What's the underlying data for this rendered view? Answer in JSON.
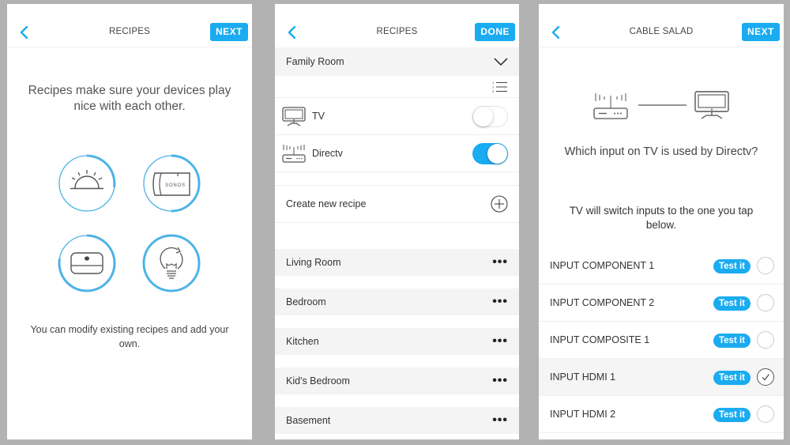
{
  "colors": {
    "accent": "#1aabf0",
    "background": "#b2b2b2"
  },
  "screens": [
    {
      "header": {
        "back_icon": "chevron-left-icon",
        "title": "RECIPES",
        "action_label": "NEXT"
      },
      "intro": "Recipes make sure your devices play nice with each other.",
      "icons": [
        "sunrise-icon",
        "sonos-speaker-icon",
        "apple-tv-icon",
        "smart-bulb-icon"
      ],
      "footer": "You can modify existing recipes and add your own."
    },
    {
      "header": {
        "back_icon": "chevron-left-icon",
        "title": "RECIPES",
        "action_label": "DONE"
      },
      "expanded_room": {
        "name": "Family Room",
        "icon": "chevron-down-icon",
        "reorder_icon": "numbered-list-icon"
      },
      "devices": [
        {
          "name": "TV",
          "icon": "tv-icon",
          "enabled": false
        },
        {
          "name": "Directv",
          "icon": "cable-box-icon",
          "enabled": true
        }
      ],
      "create_label": "Create new recipe",
      "rooms": [
        "Living Room",
        "Bedroom",
        "Kitchen",
        "Kid's Bedroom",
        "Basement"
      ],
      "more_glyph": "•••"
    },
    {
      "header": {
        "back_icon": "chevron-left-icon",
        "title": "CABLE SALAD",
        "action_label": "NEXT"
      },
      "question": "Which input on TV is used by Directv?",
      "hint": "TV will switch inputs to the one you tap below.",
      "test_label": "Test it",
      "inputs": [
        {
          "name": "INPUT COMPONENT 1",
          "selected": false
        },
        {
          "name": "INPUT COMPONENT 2",
          "selected": false
        },
        {
          "name": "INPUT COMPOSITE 1",
          "selected": false
        },
        {
          "name": "INPUT HDMI 1",
          "selected": true
        },
        {
          "name": "INPUT HDMI 2",
          "selected": false
        }
      ]
    }
  ]
}
